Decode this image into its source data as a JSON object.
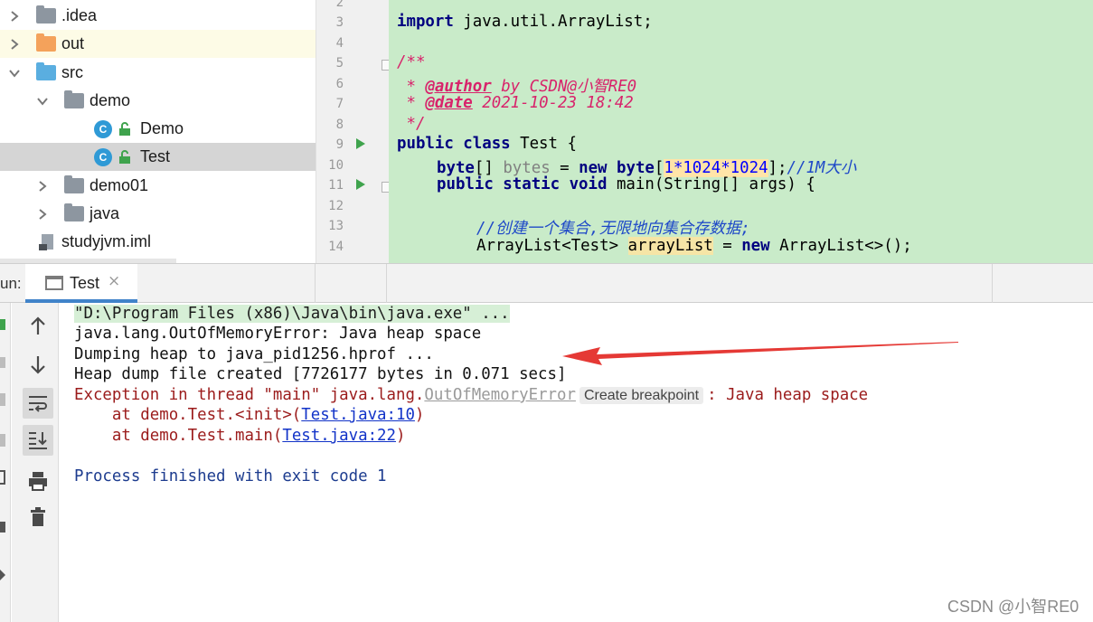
{
  "tree": {
    "items": [
      {
        "label": ".idea",
        "type": "folder",
        "color": "#8d96a0",
        "expanded": false
      },
      {
        "label": "out",
        "type": "folder",
        "color": "#f4a25b",
        "expanded": false
      },
      {
        "label": "src",
        "type": "folder",
        "color": "#5aaee0",
        "expanded": true
      },
      {
        "label": "demo",
        "type": "package",
        "color": "#8d96a0",
        "expanded": true
      },
      {
        "label": "Demo",
        "type": "class"
      },
      {
        "label": "Test",
        "type": "class",
        "selected": true
      },
      {
        "label": "demo01",
        "type": "package",
        "color": "#8d96a0",
        "expanded": false
      },
      {
        "label": "java",
        "type": "package",
        "color": "#8d96a0",
        "expanded": false
      },
      {
        "label": "studyjvm.iml",
        "type": "file"
      }
    ],
    "class_icon_letter": "C"
  },
  "editor": {
    "line_numbers": [
      "2",
      "3",
      "4",
      "5",
      "6",
      "7",
      "8",
      "9",
      "10",
      "11",
      "12",
      "13",
      "14"
    ],
    "code": {
      "l3_kw": "import",
      "l3_rest": " java.util.ArrayList;",
      "l5": "/**",
      "l6_pre": " * ",
      "l6_tag": "@author",
      "l6_rest": " by CSDN@小智RE0",
      "l7_pre": " * ",
      "l7_tag": "@date",
      "l7_rest": " 2021-10-23 18:42",
      "l8": " */",
      "l9_kw": "public class",
      "l9_rest": " Test {",
      "l10_kw": "byte",
      "l10_a": "[] ",
      "l10_var": "bytes",
      "l10_b": " = ",
      "l10_new": "new",
      "l10_c": " ",
      "l10_byte": "byte",
      "l10_d": "[",
      "l10_num": "1*1024*1024",
      "l10_e": "];",
      "l10_comment": "//1M大小",
      "l11_kw": "public static void",
      "l11_rest": " main(String[] args) {",
      "l13_comment": "//创建一个集合,无限地向集合存数据;",
      "l14_a": "ArrayList<Test> ",
      "l14_var": "arrayList",
      "l14_b": " = ",
      "l14_new": "new",
      "l14_c": " ArrayList<>();"
    }
  },
  "run": {
    "label": "un:",
    "tab_label": "Test",
    "tab_close": "×"
  },
  "console": {
    "cmd": "\"D:\\Program Files (x86)\\Java\\bin\\java.exe\" ...",
    "line2": "java.lang.OutOfMemoryError: Java heap space",
    "line3": "Dumping heap to java_pid1256.hprof ...",
    "line4": "Heap dump file created [7726177 bytes in 0.071 secs]",
    "line5_pre": "Exception in thread \"main\" java.lang.",
    "line5_link": "OutOfMemoryError",
    "line5_chip": "Create breakpoint",
    "line5_post": ": Java heap space",
    "line6_pre": "    at demo.Test.<init>(",
    "line6_link": "Test.java:10",
    "line6_post": ")",
    "line7_pre": "    at demo.Test.main(",
    "line7_link": "Test.java:22",
    "line7_post": ")",
    "line8": "Process finished with exit code 1"
  },
  "watermark": "CSDN @小智RE0",
  "colors": {
    "code_bg": "#c9ebc9",
    "error_text": "#9b1b1b",
    "arrow": "#e53935",
    "tab_underline": "#4083c9"
  }
}
